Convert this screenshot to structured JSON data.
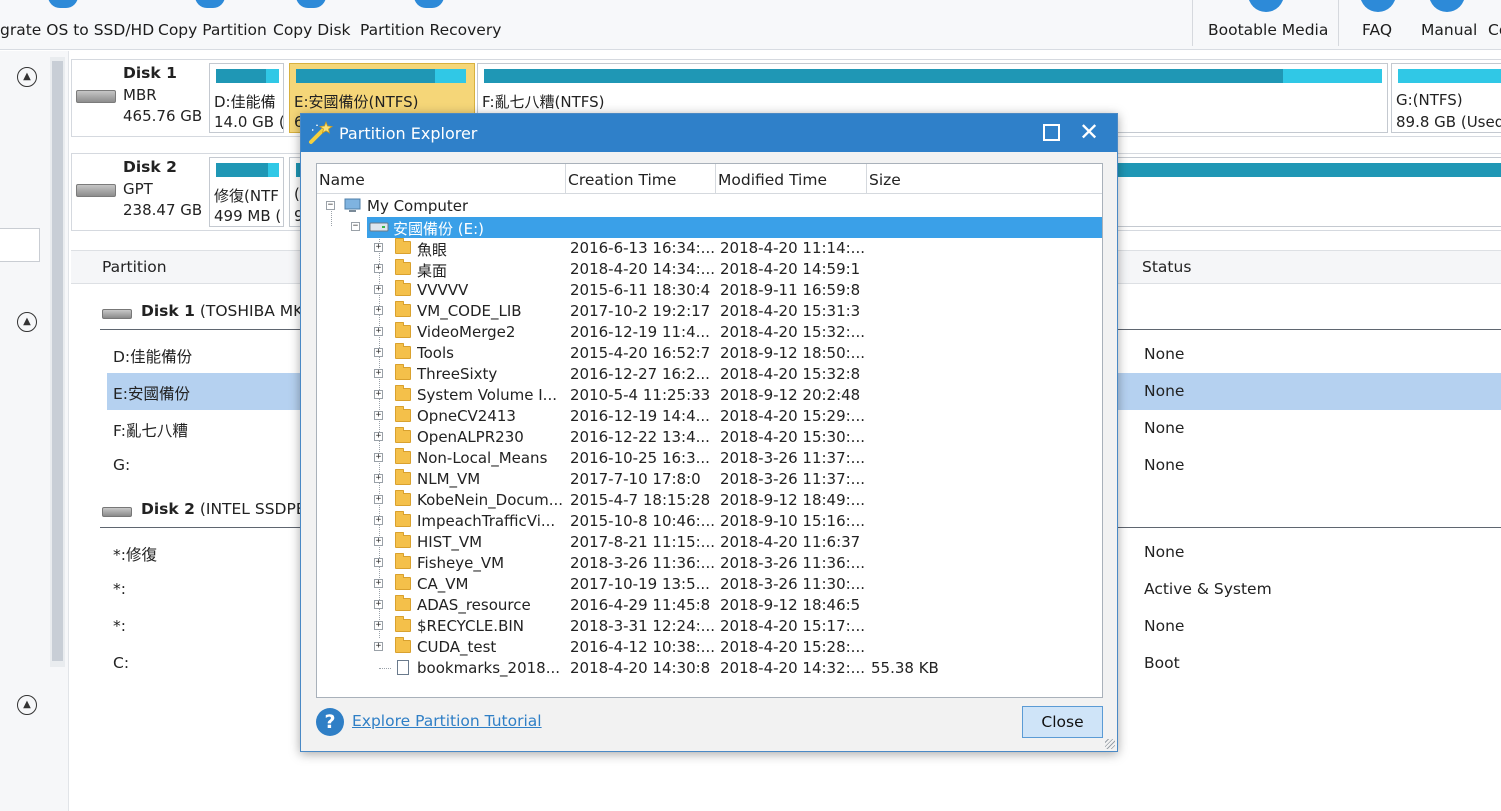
{
  "toolbar": {
    "items": [
      {
        "label": "grate OS to SSD/HD",
        "icon": "migrate-icon"
      },
      {
        "label": "Copy Partition",
        "icon": "copy-partition-icon"
      },
      {
        "label": "Copy Disk",
        "icon": "copy-disk-icon"
      },
      {
        "label": "Partition Recovery",
        "icon": "partition-recovery-icon"
      },
      {
        "label": "Bootable Media",
        "icon": "bootable-media-icon"
      },
      {
        "label": "FAQ",
        "icon": "faq-icon"
      },
      {
        "label": "Manual",
        "icon": "manual-icon"
      },
      {
        "label": "Co",
        "icon": "contact-icon"
      }
    ]
  },
  "disk_map": {
    "disk1": {
      "name": "Disk 1",
      "type": "MBR",
      "size": "465.76 GB",
      "partitions": [
        {
          "label": "D:佳能備",
          "sub": "14.0 GB (",
          "used_fraction": 0.8
        },
        {
          "label": "E:安國備份(NTFS)",
          "sub": "6",
          "used_fraction": 0.8,
          "selected": true
        },
        {
          "label": "F:亂七八糟(NTFS)",
          "sub": "",
          "used_fraction": 0.88
        },
        {
          "label": "G:(NTFS)",
          "sub": "89.8 GB (Used",
          "used_fraction": 0.0
        }
      ]
    },
    "disk2": {
      "name": "Disk 2",
      "type": "GPT",
      "size": "238.47 GB",
      "partitions": [
        {
          "label": "修復(NTF",
          "sub": "499 MB (",
          "used_fraction": 0.82
        },
        {
          "label": "(",
          "sub": "9",
          "used_fraction": 0.5
        }
      ]
    }
  },
  "table": {
    "headers": {
      "partition": "Partition",
      "status": "Status"
    },
    "groups": [
      {
        "disk": "Disk 1",
        "model": " (TOSHIBA MK"
      },
      {
        "disk": "Disk 2",
        "model": " (INTEL SSDPE"
      }
    ],
    "rows": [
      {
        "name": "D:佳能備份",
        "status": "None"
      },
      {
        "name": "E:安國備份",
        "status": "None",
        "selected": true
      },
      {
        "name": "F:亂七八糟",
        "status": "None"
      },
      {
        "name": "G:",
        "status": "None"
      },
      {
        "name": "*:修復",
        "status": "None"
      },
      {
        "name": "*:",
        "status": "Active & System"
      },
      {
        "name": "*:",
        "status": "None"
      },
      {
        "name": "C:",
        "status": "Boot"
      }
    ]
  },
  "dialog": {
    "title": "Partition Explorer",
    "columns": [
      "Name",
      "Creation Time",
      "Modified Time",
      "Size"
    ],
    "root": "My Computer",
    "drive": "安國備份 (E:)",
    "entries": [
      {
        "name": "魚眼",
        "created": "2016-6-13 16:34:...",
        "modified": "2018-4-20 11:14:...",
        "size": "",
        "kind": "folder"
      },
      {
        "name": "桌面",
        "created": "2018-4-20 14:34:...",
        "modified": "2018-4-20 14:59:1",
        "size": "",
        "kind": "folder"
      },
      {
        "name": "VVVVV",
        "created": "2015-6-11 18:30:4",
        "modified": "2018-9-11 16:59:8",
        "size": "",
        "kind": "folder"
      },
      {
        "name": "VM_CODE_LIB",
        "created": "2017-10-2 19:2:17",
        "modified": "2018-4-20 15:31:3",
        "size": "",
        "kind": "folder"
      },
      {
        "name": "VideoMerge2",
        "created": "2016-12-19 11:4...",
        "modified": "2018-4-20 15:32:...",
        "size": "",
        "kind": "folder"
      },
      {
        "name": "Tools",
        "created": "2015-4-20 16:52:7",
        "modified": "2018-9-12 18:50:...",
        "size": "",
        "kind": "folder"
      },
      {
        "name": "ThreeSixty",
        "created": "2016-12-27 16:2...",
        "modified": "2018-4-20 15:32:8",
        "size": "",
        "kind": "folder"
      },
      {
        "name": "System Volume I...",
        "created": "2010-5-4 11:25:33",
        "modified": "2018-9-12 20:2:48",
        "size": "",
        "kind": "folder"
      },
      {
        "name": "OpneCV2413",
        "created": "2016-12-19 14:4...",
        "modified": "2018-4-20 15:29:...",
        "size": "",
        "kind": "folder"
      },
      {
        "name": "OpenALPR230",
        "created": "2016-12-22 13:4...",
        "modified": "2018-4-20 15:30:...",
        "size": "",
        "kind": "folder"
      },
      {
        "name": "Non-Local_Means",
        "created": "2016-10-25 16:3...",
        "modified": "2018-3-26 11:37:...",
        "size": "",
        "kind": "folder"
      },
      {
        "name": "NLM_VM",
        "created": "2017-7-10 17:8:0",
        "modified": "2018-3-26 11:37:...",
        "size": "",
        "kind": "folder"
      },
      {
        "name": "KobeNein_Docum...",
        "created": "2015-4-7 18:15:28",
        "modified": "2018-9-12 18:49:...",
        "size": "",
        "kind": "folder"
      },
      {
        "name": "ImpeachTrafficVi...",
        "created": "2015-10-8 10:46:...",
        "modified": "2018-9-10 15:16:...",
        "size": "",
        "kind": "folder"
      },
      {
        "name": "HIST_VM",
        "created": "2017-8-21 11:15:...",
        "modified": "2018-4-20 11:6:37",
        "size": "",
        "kind": "folder"
      },
      {
        "name": "Fisheye_VM",
        "created": "2018-3-26 11:36:...",
        "modified": "2018-3-26 11:36:...",
        "size": "",
        "kind": "folder"
      },
      {
        "name": "CA_VM",
        "created": "2017-10-19 13:5...",
        "modified": "2018-3-26 11:30:...",
        "size": "",
        "kind": "folder"
      },
      {
        "name": "ADAS_resource",
        "created": "2016-4-29 11:45:8",
        "modified": "2018-9-12 18:46:5",
        "size": "",
        "kind": "folder"
      },
      {
        "name": "$RECYCLE.BIN",
        "created": "2018-3-31 12:24:...",
        "modified": "2018-4-20 15:17:...",
        "size": "",
        "kind": "folder"
      },
      {
        "name": "CUDA_test",
        "created": "2016-4-12 10:38:...",
        "modified": "2018-4-20 15:28:...",
        "size": "",
        "kind": "folder"
      },
      {
        "name": "bookmarks_2018...",
        "created": "2018-4-20 14:30:8",
        "modified": "2018-4-20 14:32:...",
        "size": "55.38 KB",
        "kind": "file"
      }
    ],
    "help_link": "Explore Partition Tutorial",
    "close_button": "Close"
  }
}
